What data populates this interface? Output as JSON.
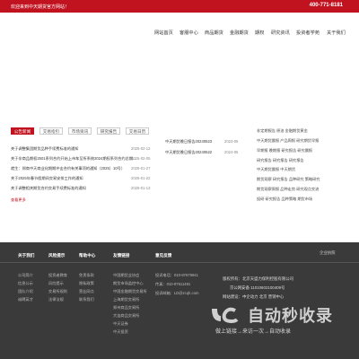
{
  "topbar": {
    "welcome": "欢迎来到中天期货官方网站！",
    "phone": "400-771-8181"
  },
  "nav": [
    "网站首页",
    "客服中心",
    "商品期货",
    "金融期货",
    "期权",
    "研究资讯",
    "投资者学苑",
    "关于我们"
  ],
  "tabs": [
    "公告新闻",
    "交易指引",
    "市场资讯",
    "研究报告",
    "交易日历"
  ],
  "news": [
    {
      "title": "关于调整集团期货品种手续费标准的通知",
      "date": "2025-02-12"
    },
    {
      "title": "关于非商品期权2501系列合约开始上市车至所系统2024期权系列合约总期...",
      "date": "2025-02-05"
    },
    {
      "title": "就生：郑商中天商业化期期冲击合约有关事项的通知（2025）10号）",
      "date": "2025-01-27"
    },
    {
      "title": "关于2025年春节假期间交易安排工作的通知",
      "date": "2025-01-22"
    },
    {
      "title": "关于调整相关期货合约交易手续费标准的通知",
      "date": "2025-01-13"
    }
  ],
  "more": "查看更多",
  "mid": [
    {
      "title": "中天期货晚日报告20240523",
      "date": "2024-05"
    },
    {
      "title": "中天期货晚日报告20240522",
      "date": "2024-05"
    }
  ],
  "right": [
    "非定期报告 原油 金融期货黄金",
    "中天期货晨报 产品周报 研究期货早报",
    "早期报 晚期报 研究报告 研究晨报",
    "研究报告 研究报告 研究报告",
    "中天期货晨报 中天期货",
    "期货观察 研究报告 品种研究 策略研究",
    "期货观察周报 品种走势 研究观点交流",
    "投研 研究报告 品种策略 期货市场"
  ],
  "footer": {
    "columns": [
      {
        "heading": "关于我们",
        "links": [
          "公司简介",
          "信息公示",
          "团队介绍",
          "诚聘英才"
        ]
      },
      {
        "heading": "风险提示",
        "links": [
          "投资者教育",
          "风险提示",
          "交易所规则",
          "法律法规"
        ]
      },
      {
        "heading": "帮助中心",
        "links": [
          "免责条款",
          "隐私政策",
          "营业网点",
          "联系我们"
        ]
      },
      {
        "heading": "友情链接",
        "links": [
          "中国期货业协会",
          "期货市场监控中心",
          "中国金融期货交易所",
          "上海期货交易所",
          "郑州商品交易所",
          "大连商品交易所",
          "中天证券",
          "中天投资"
        ]
      },
      {
        "heading": "意见反馈",
        "links": [
          "投诉电话：010-87679941",
          "传真：010-87611491",
          "投诉邮箱：LD@zcqh.com"
        ]
      }
    ],
    "right_lines": [
      "版权所有：北京天盛力保利控股有限公司",
      "京公网安备 11010602100409号",
      "网站建设：中企动力 北京 营销中心"
    ],
    "qr_label": "企业执照"
  },
  "watermark": {
    "main": "自动秒收录",
    "sub": "做上链接→来访一次→自动收录"
  },
  "colors": {
    "brand": "#c1121f",
    "footer": "#3a3a3a"
  }
}
